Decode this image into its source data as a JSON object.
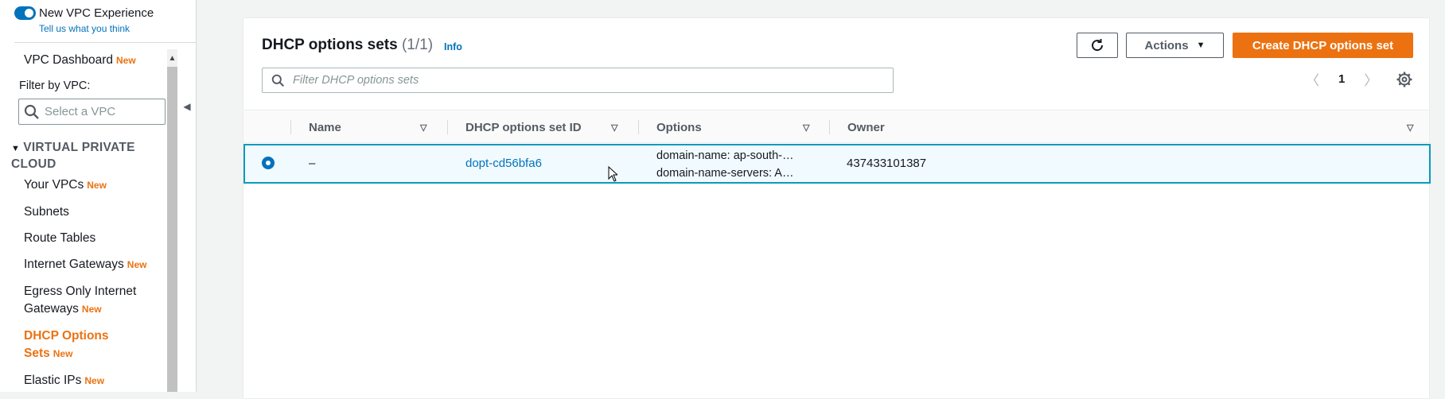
{
  "sidebar": {
    "toggle_label": "New VPC Experience",
    "feedback_link": "Tell us what you think",
    "dashboard": "VPC Dashboard",
    "new_badge": "New",
    "filter_label": "Filter by VPC:",
    "vpc_placeholder": "Select a VPC",
    "section_title": "VIRTUAL PRIVATE CLOUD",
    "items": [
      {
        "label": "Your VPCs",
        "badge": "New"
      },
      {
        "label": "Subnets",
        "badge": ""
      },
      {
        "label": "Route Tables",
        "badge": ""
      },
      {
        "label": "Internet Gateways",
        "badge": "New"
      },
      {
        "label": "Egress Only Internet",
        "label2": "Gateways",
        "badge": "New"
      },
      {
        "label": "DHCP Options",
        "label2": "Sets",
        "badge": "New",
        "active": true
      },
      {
        "label": "Elastic IPs",
        "badge": "New"
      }
    ]
  },
  "panel": {
    "title": "DHCP options sets",
    "count": "(1/1)",
    "info": "Info",
    "actions_label": "Actions",
    "create_label": "Create DHCP options set",
    "search_placeholder": "Filter DHCP options sets",
    "page_number": "1"
  },
  "table": {
    "columns": [
      "Name",
      "DHCP options set ID",
      "Options",
      "Owner"
    ],
    "rows": [
      {
        "name": "–",
        "id": "dopt-cd56bfa6",
        "options_line1": "domain-name: ap-south-…",
        "options_line2": "domain-name-servers: A…",
        "owner": "437433101387",
        "selected": true
      }
    ]
  },
  "colors": {
    "accent": "#0073bb",
    "primary_button": "#ec7211",
    "selected_row_border": "#0a9bbd"
  },
  "icons": [
    "search-icon",
    "refresh-icon",
    "caret-down-icon",
    "chevron-left-icon",
    "chevron-right-icon",
    "settings-icon",
    "sort-icon",
    "collapse-icon"
  ]
}
